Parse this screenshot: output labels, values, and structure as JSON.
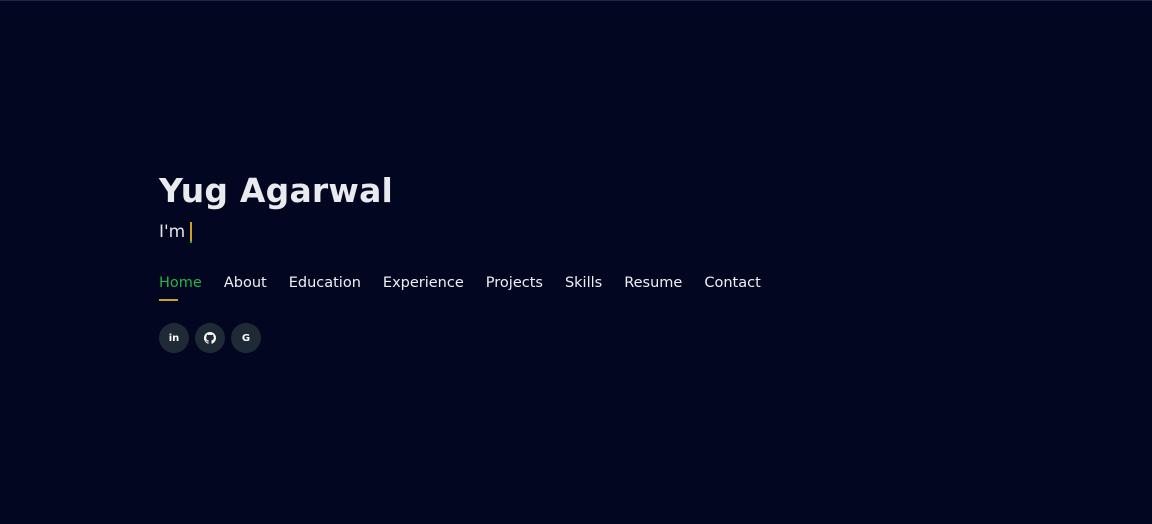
{
  "hero": {
    "name": "Yug Agarwal",
    "typed_prefix": "I'm"
  },
  "nav": {
    "items": [
      {
        "label": "Home",
        "active": true
      },
      {
        "label": "About",
        "active": false
      },
      {
        "label": "Education",
        "active": false
      },
      {
        "label": "Experience",
        "active": false
      },
      {
        "label": "Projects",
        "active": false
      },
      {
        "label": "Skills",
        "active": false
      },
      {
        "label": "Resume",
        "active": false
      },
      {
        "label": "Contact",
        "active": false
      }
    ]
  },
  "socials": {
    "items": [
      {
        "icon": "linkedin-icon",
        "glyph": "in"
      },
      {
        "icon": "github-icon",
        "glyph": ""
      },
      {
        "icon": "google-icon",
        "glyph": "G"
      }
    ]
  },
  "colors": {
    "background": "#030620",
    "accent_green": "#2bb34b",
    "accent_gold": "#c9a227",
    "social_bg": "#1f2a37"
  }
}
